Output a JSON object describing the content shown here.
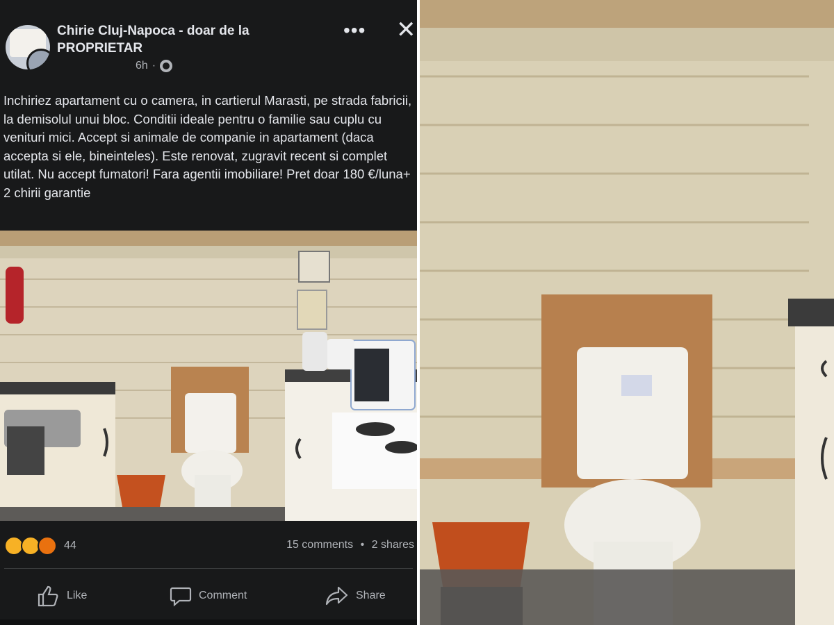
{
  "post": {
    "group_name": "Chirie Cluj-Napoca - doar de la PROPRIETAR",
    "time": "6h",
    "separator": "·",
    "text": "Inchiriez apartament cu o camera, in cartierul Marasti, pe strada fabricii, la demisolul unui bloc. Conditii ideale pentru o familie sau cuplu cu venituri mici. Accept si animale de companie in apartament (daca accepta si ele, bineinteles). Este renovat, zugravit recent si complet utilat. Nu accept fumatori! Fara agentii imobiliare! Pret doar 180 €/luna+ 2 chirii garantie"
  },
  "header": {
    "more_label": "•••",
    "close_label": "✕"
  },
  "reactions": {
    "icons": [
      "haha-icon",
      "wow-icon",
      "angry-icon"
    ],
    "count": "44",
    "comments": "15 comments",
    "dot": "•",
    "shares": "2 shares"
  },
  "actions": {
    "like": "Like",
    "comment": "Comment",
    "share": "Share"
  },
  "colors": {
    "background": "#18191a",
    "text": "#e4e6eb",
    "muted": "#b0b3b8"
  }
}
